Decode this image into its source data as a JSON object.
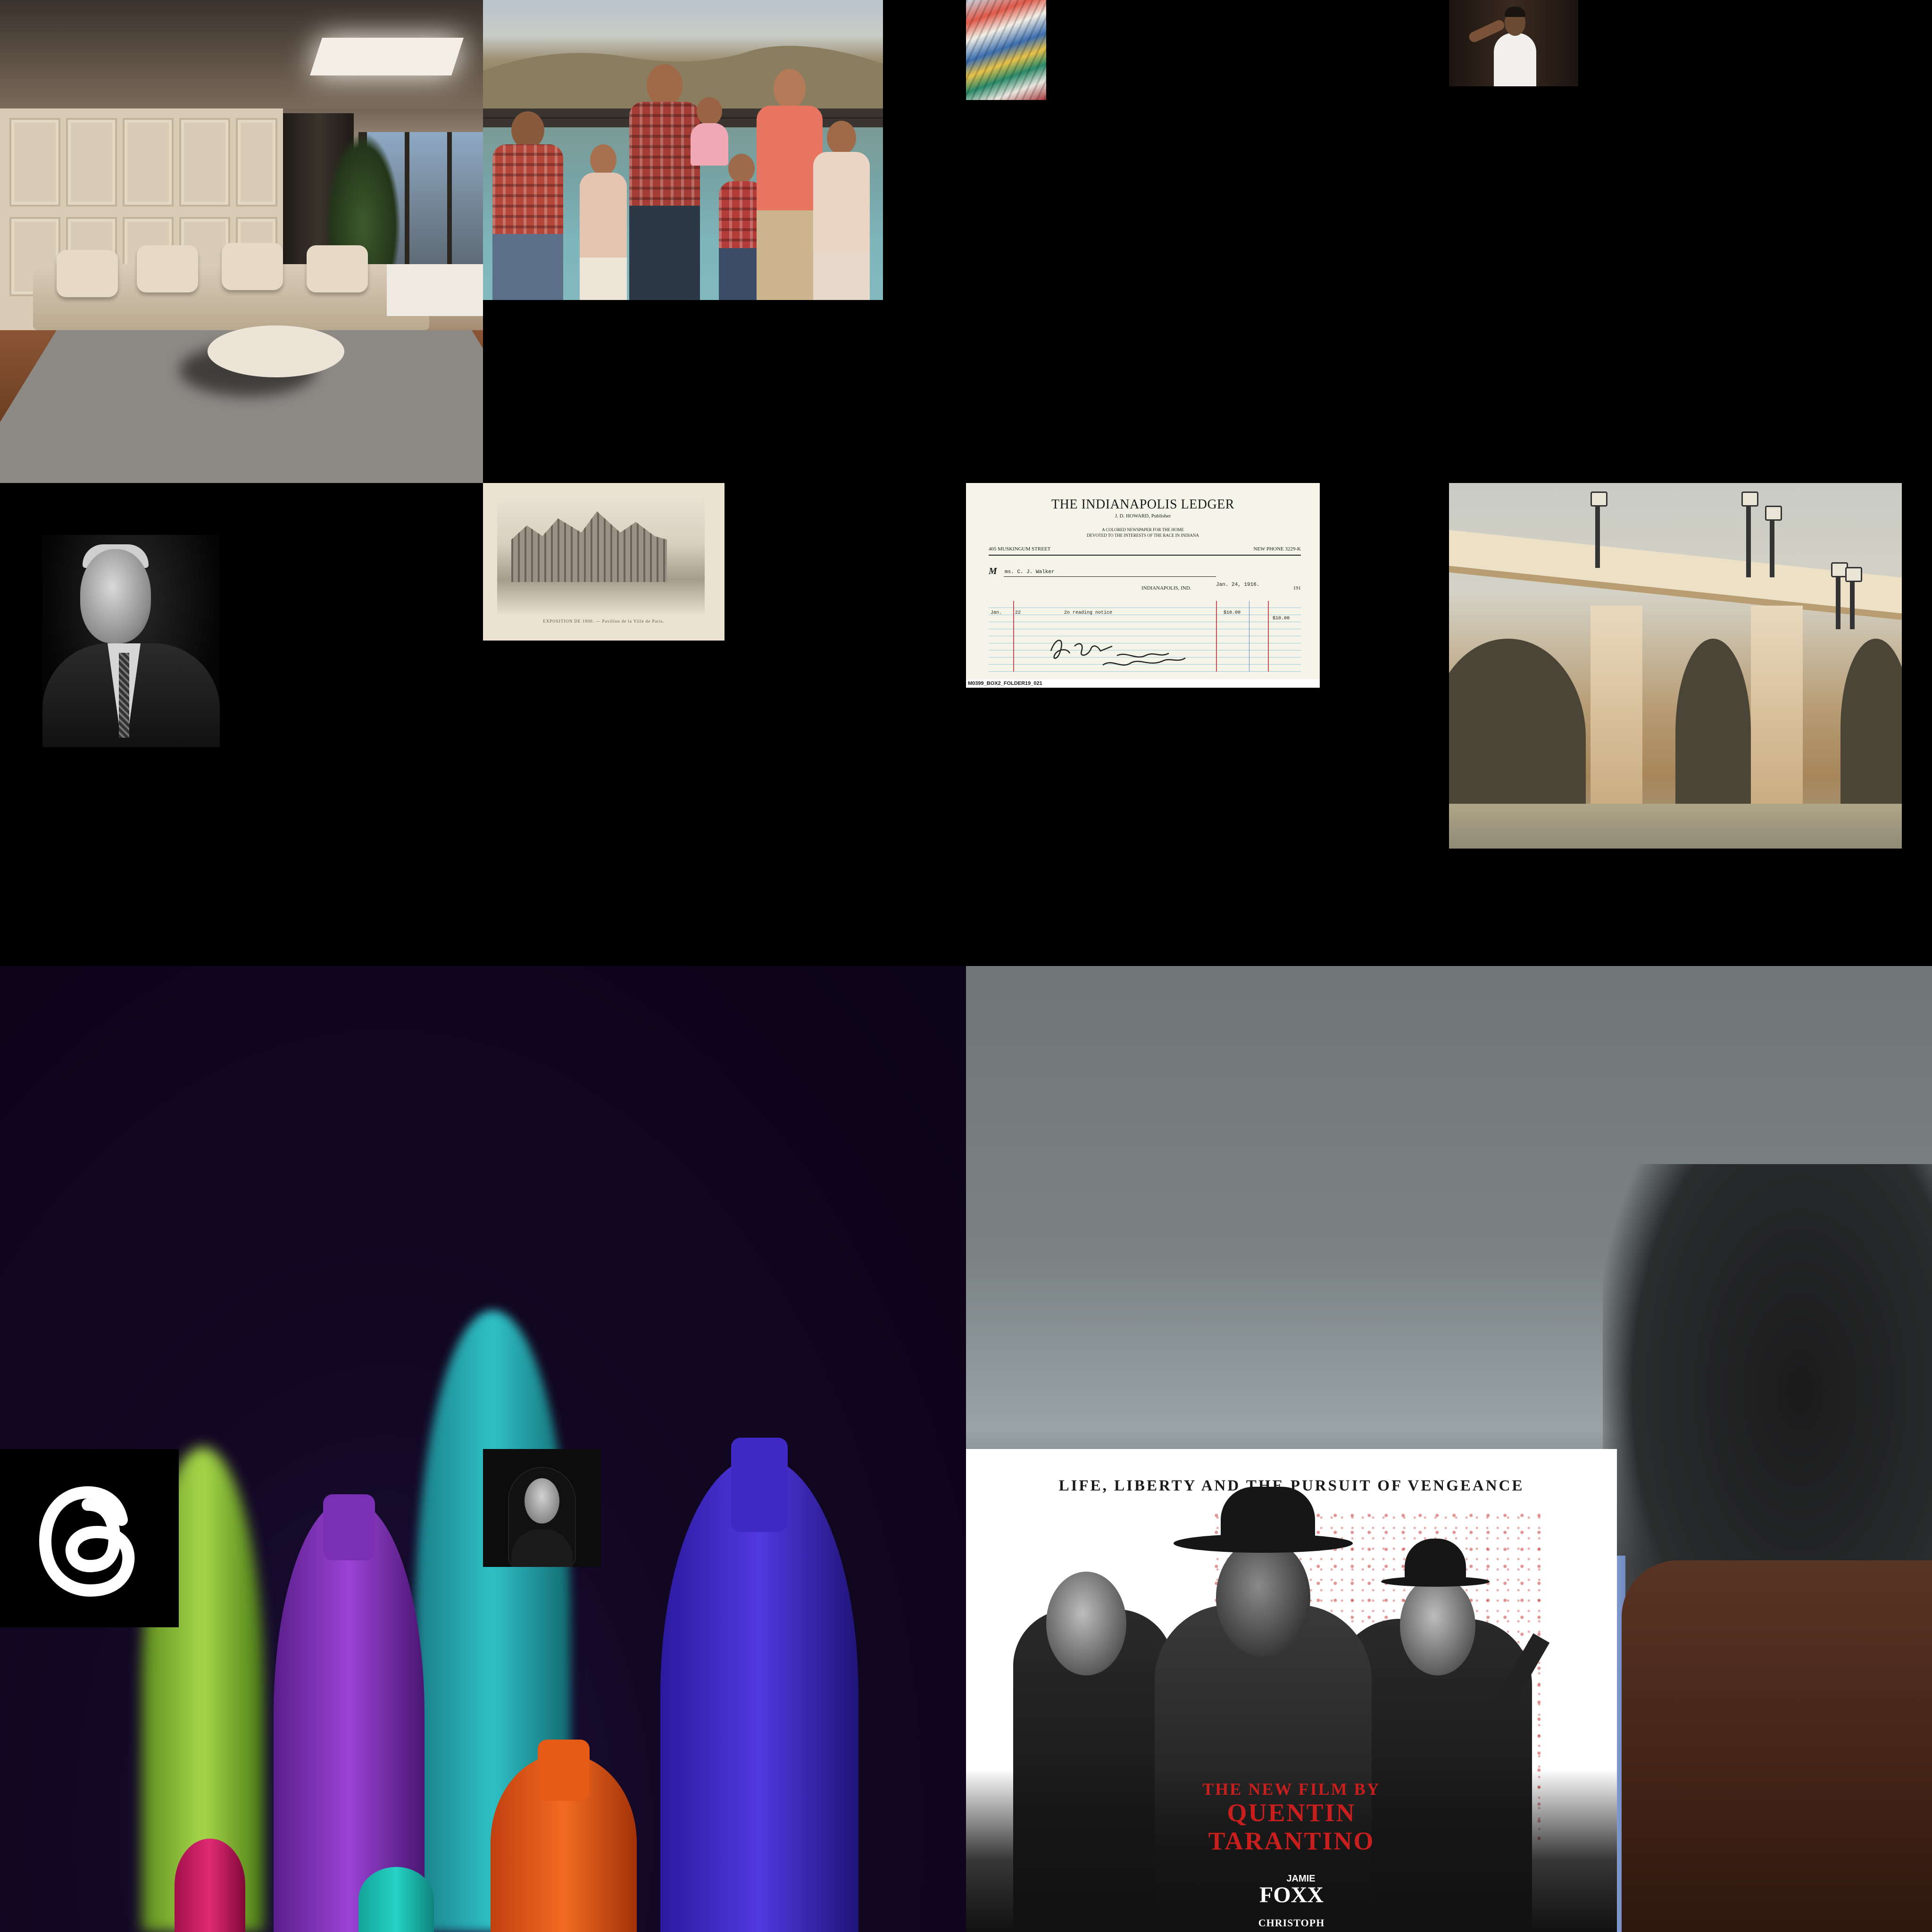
{
  "images": [
    {
      "name": "living-room-photo"
    },
    {
      "name": "family-photo"
    },
    {
      "name": "art-poster-thumb"
    },
    {
      "name": "chef-photo"
    },
    {
      "name": "portrait-man"
    },
    {
      "name": "expo-postcard"
    },
    {
      "name": "ledger-receipt"
    },
    {
      "name": "bridge-painting"
    },
    {
      "name": "crayons-photo"
    },
    {
      "name": "blurry-photo"
    },
    {
      "name": "threads-logo"
    },
    {
      "name": "woman-portrait"
    },
    {
      "name": "movie-poster"
    }
  ],
  "postcard": {
    "caption": "EXPOSITION DE 1900. — Pavillon de la Ville de Paris."
  },
  "ledger": {
    "title": "THE INDIANAPOLIS LEDGER",
    "publisher": "J. D. HOWARD, Publisher",
    "tagline_1": "A COLORED NEWSPAPER FOR THE HOME",
    "tagline_2": "DEVOTED TO THE INTERESTS OF THE RACE IN INDIANA",
    "address": "405 MUSKINGUM STREET",
    "phone": "NEW PHONE 3229-K",
    "to_prefix": "M",
    "to_name": "ms. C. J. Walker",
    "city": "INDIANAPOLIS, IND.",
    "date": "Jan. 24, 1916.",
    "year_suffix": "191",
    "row_month": "Jan.",
    "row_day": "22",
    "row_text": "2o reading notice",
    "amount_1": "$10.00",
    "amount_2": "$10.00",
    "signature": "Rec Payment J. D. Howard",
    "footer": "M0399_BOX2_FOLDER19_021"
  },
  "poster": {
    "tagline": "LIFE, LIBERTY AND THE PURSUIT OF VENGEANCE",
    "credit_line_1": "THE NEW FILM BY",
    "credit_line_2": "QUENTIN",
    "credit_line_3": "TARANTINO",
    "actor_first": "JAMIE",
    "actor_last": "FOXX",
    "actor_next": "CHRISTOPH"
  },
  "threads": {
    "icon": "threads-at-icon",
    "fg": "#ffffff",
    "bg": "#000000"
  }
}
